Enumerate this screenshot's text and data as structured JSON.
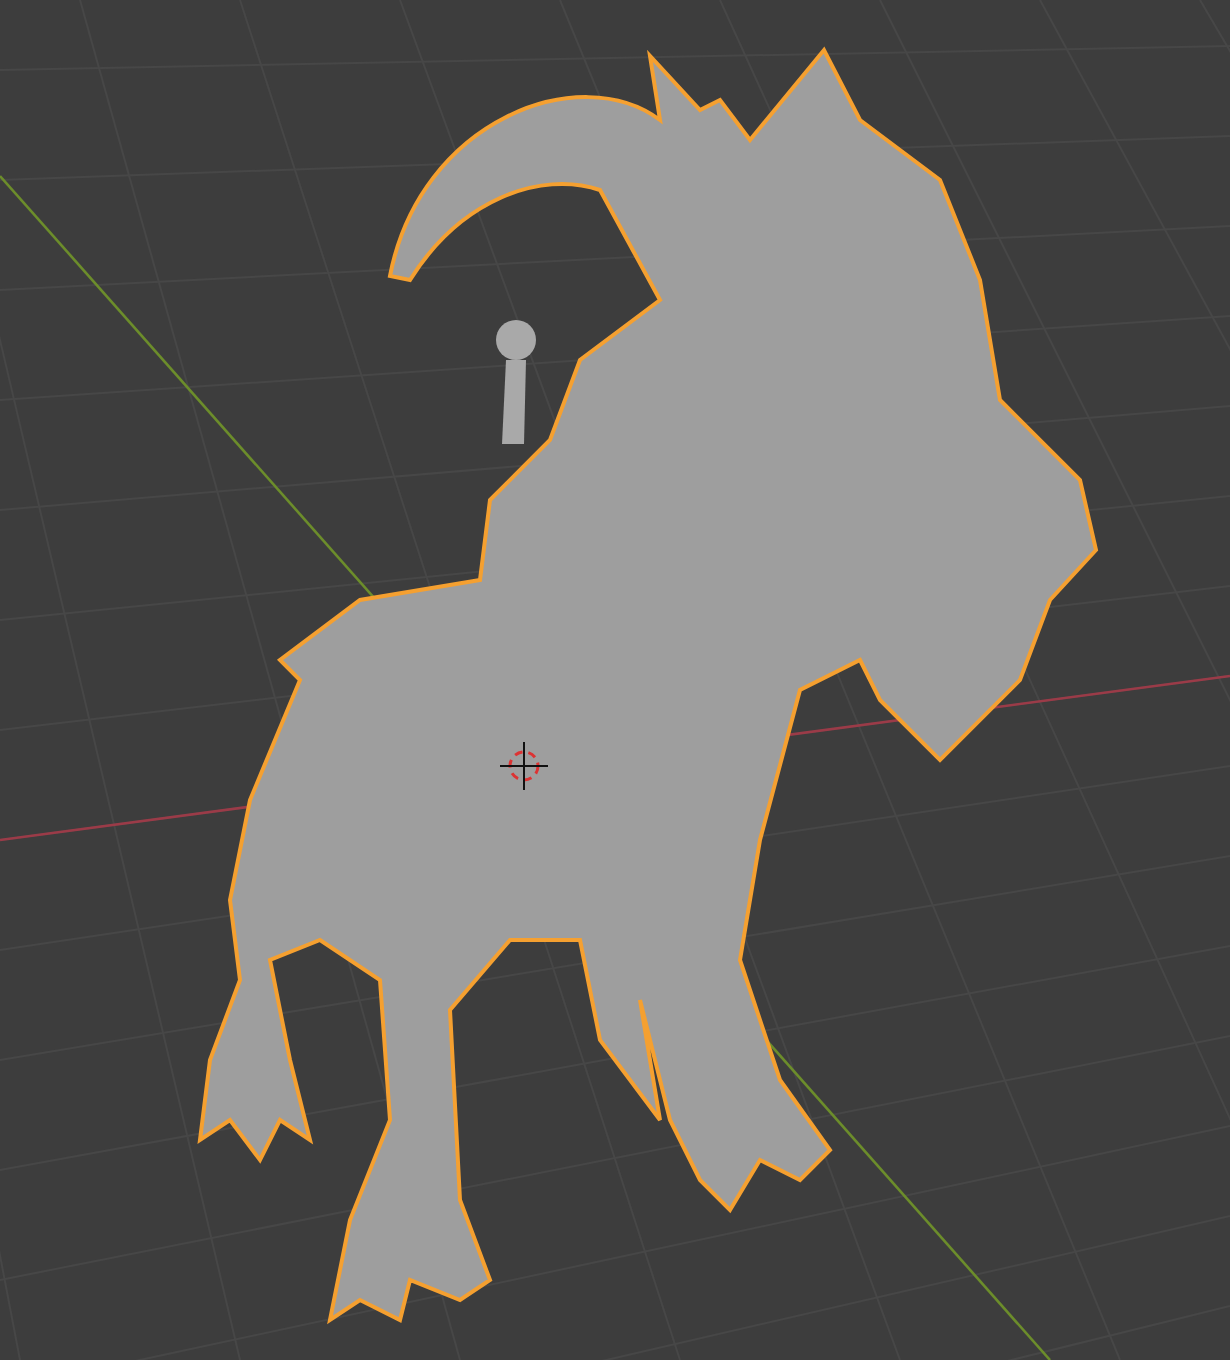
{
  "viewport": {
    "object": {
      "selected": true
    }
  }
}
